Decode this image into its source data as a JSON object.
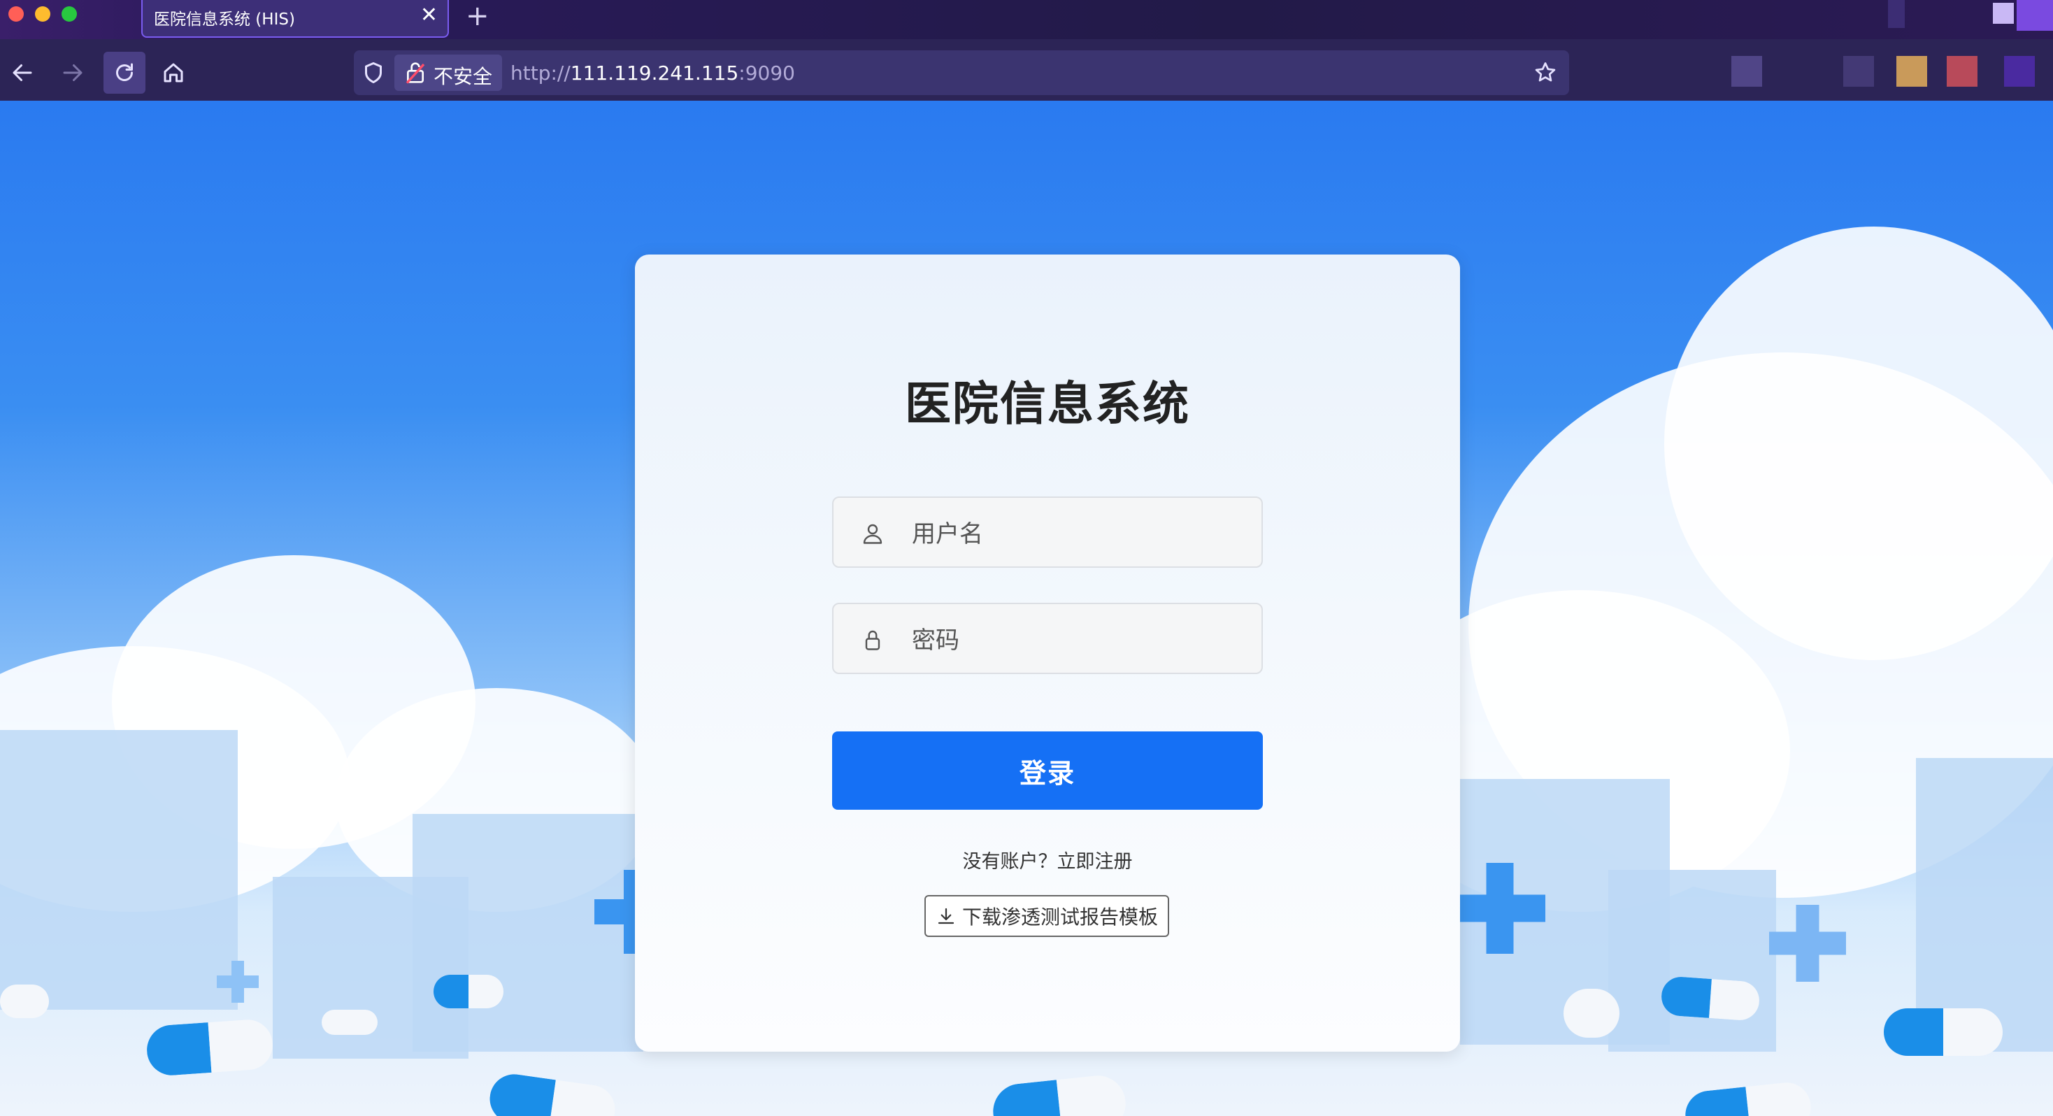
{
  "browser": {
    "tab_title": "医院信息系统 (HIS)",
    "tab_close": "✕",
    "new_tab": "+",
    "security_label": "不安全",
    "url_scheme": "http://",
    "url_host": "111.119.241.115",
    "url_port": ":9090"
  },
  "login": {
    "title": "医院信息系统",
    "username_placeholder": "用户名",
    "password_placeholder": "密码",
    "submit_label": "登录",
    "register_text": "没有账户？立即注册",
    "download_label": "下载渗透测试报告模板"
  },
  "colors": {
    "primary": "#1570f5",
    "sky": "#2a7af0",
    "chrome": "#2c2456"
  }
}
